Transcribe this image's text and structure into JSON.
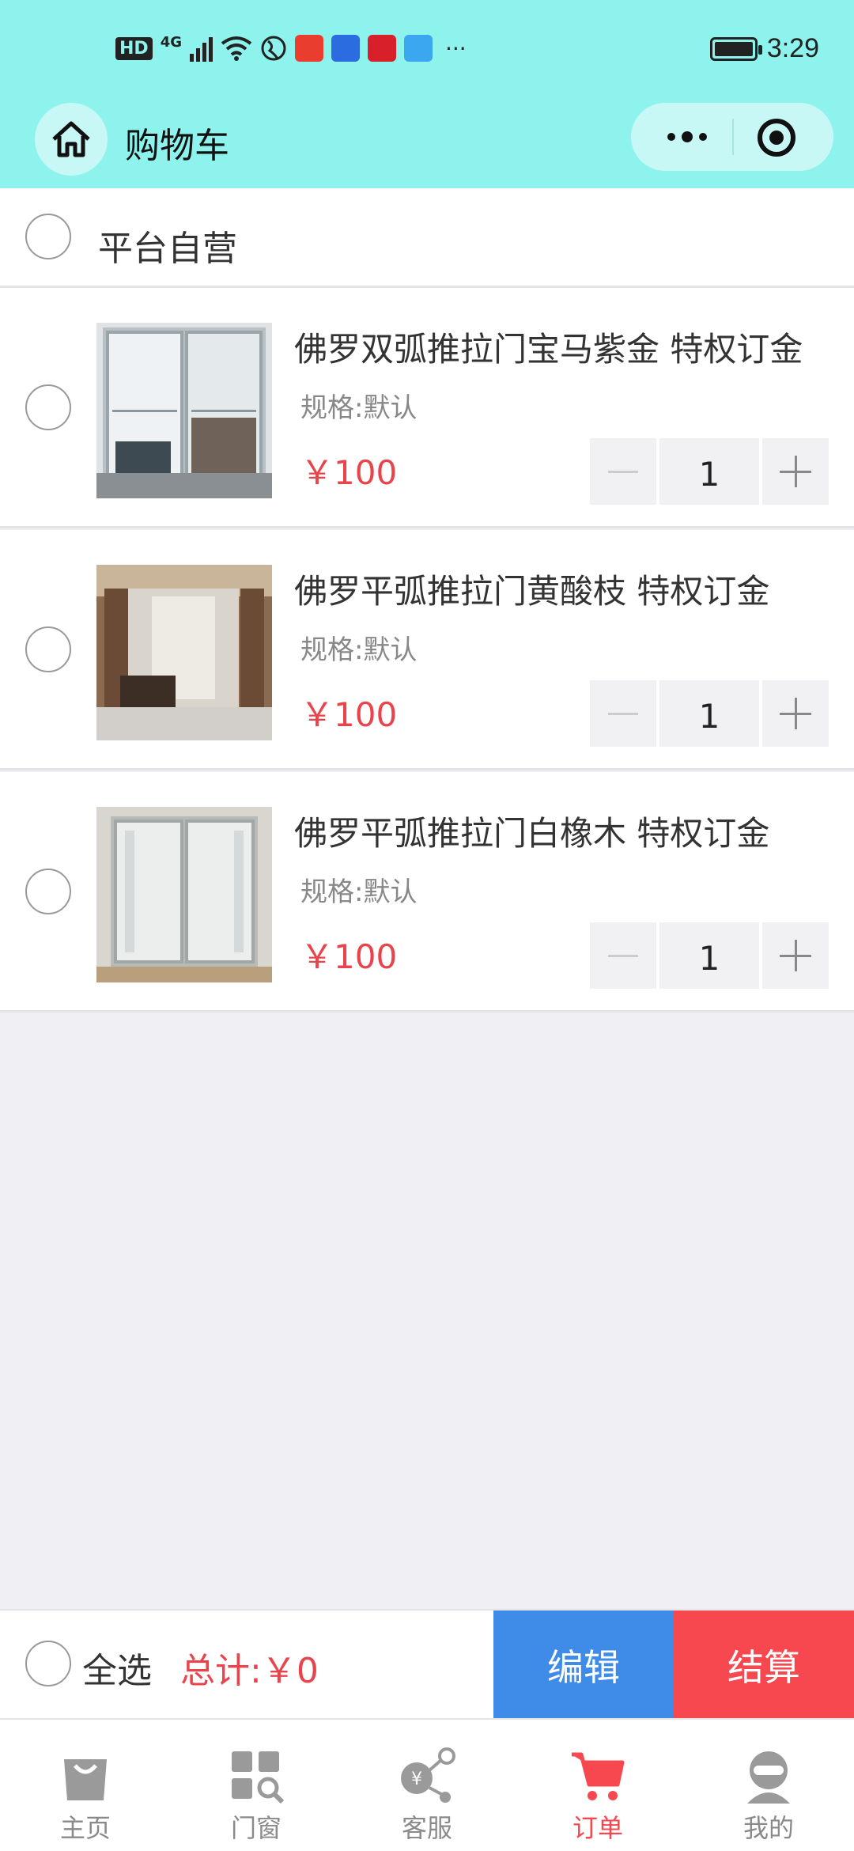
{
  "status_bar": {
    "left_badges": [
      "HD",
      "4G"
    ],
    "time": "3:29"
  },
  "header": {
    "title": "购物车",
    "home_icon": "home-icon",
    "more_icon": "more-dots-icon",
    "close_icon": "target-icon"
  },
  "store": {
    "name": "平台自营"
  },
  "items": [
    {
      "name": "佛罗双弧推拉门宝马紫金 特权订金",
      "spec": "规格:默认",
      "price": "￥100",
      "qty": "1"
    },
    {
      "name": "佛罗平弧推拉门黄酸枝 特权订金",
      "spec": "规格:默认",
      "price": "￥100",
      "qty": "1"
    },
    {
      "name": "佛罗平弧推拉门白橡木 特权订金",
      "spec": "规格:默认",
      "price": "￥100",
      "qty": "1"
    }
  ],
  "checkout": {
    "select_all": "全选",
    "total": "总计:￥0",
    "edit": "编辑",
    "pay": "结算"
  },
  "tabbar": {
    "tabs": [
      {
        "label": "主页",
        "icon": "shopping-bag-icon"
      },
      {
        "label": "门窗",
        "icon": "grid-search-icon"
      },
      {
        "label": "客服",
        "icon": "service-nodes-icon"
      },
      {
        "label": "订单",
        "icon": "cart-icon"
      },
      {
        "label": "我的",
        "icon": "profile-icon"
      }
    ],
    "active_index": 3
  },
  "colors": {
    "header_bg": "#8df3ec",
    "price_red": "#e9434b",
    "edit_blue": "#3f8ce8",
    "pay_red": "#f7474f",
    "page_bg": "#efeff4"
  }
}
